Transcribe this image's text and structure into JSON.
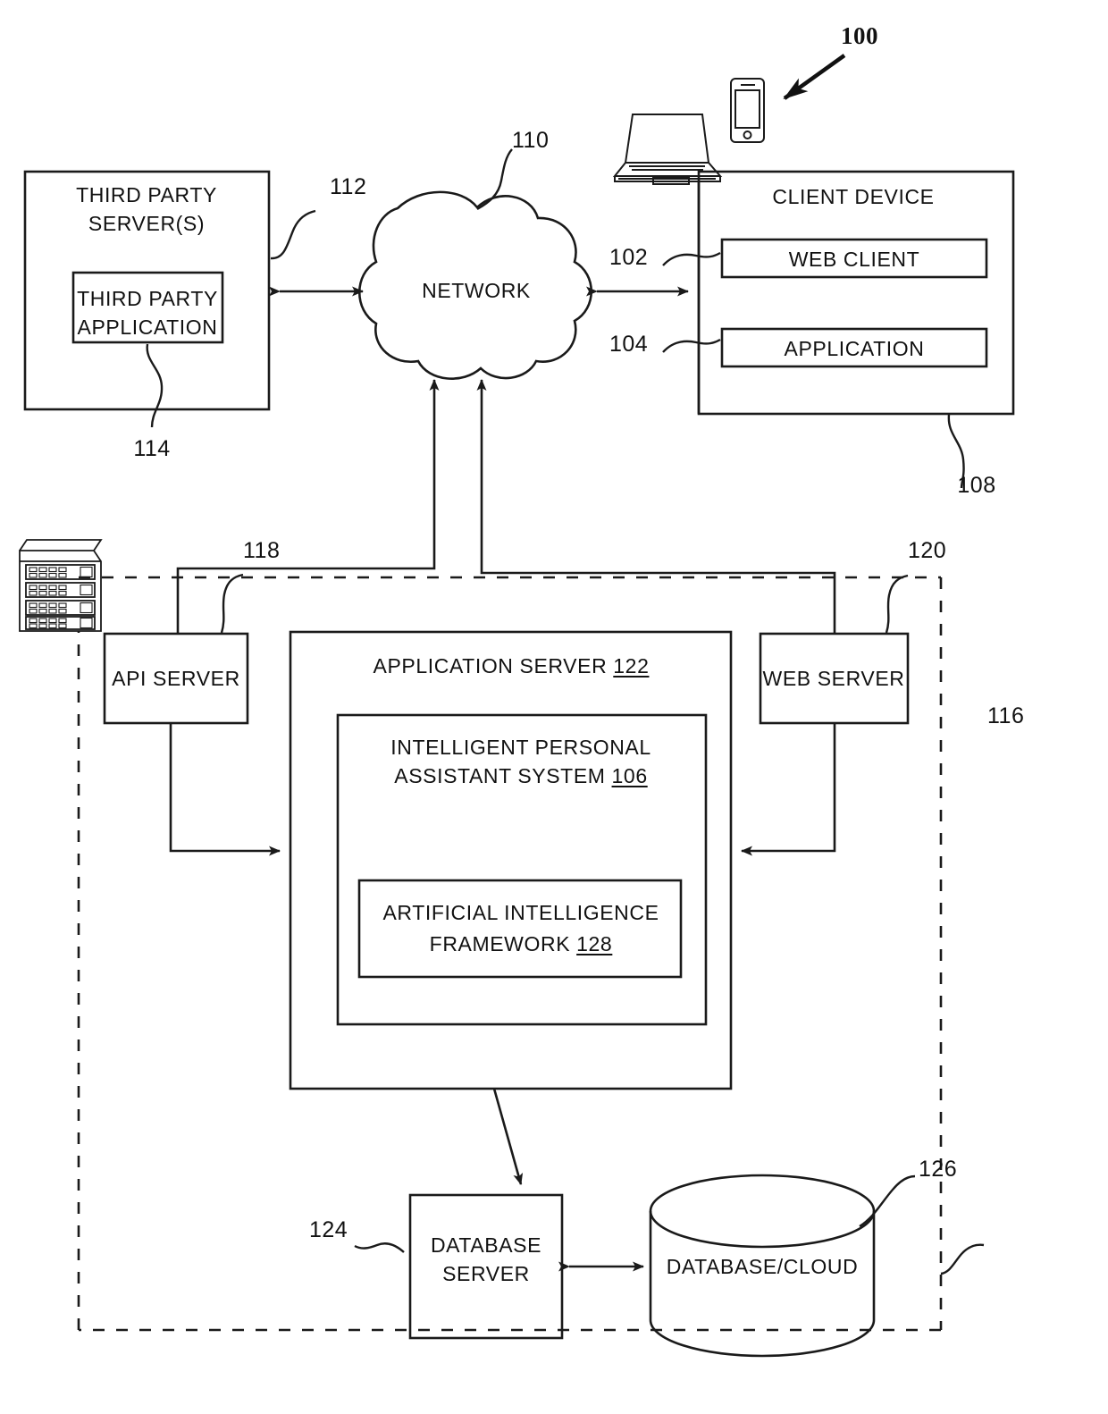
{
  "figure": {
    "reference_100": "100",
    "nodes": {
      "third_party_server": {
        "label": "THIRD PARTY\nSERVER(S)",
        "line1": "THIRD PARTY",
        "line2": "SERVER(S)",
        "ref": "112"
      },
      "third_party_application": {
        "line1": "THIRD PARTY",
        "line2": "APPLICATION",
        "ref": "114"
      },
      "network": {
        "label": "NETWORK",
        "ref": "110"
      },
      "client_device": {
        "label": "CLIENT DEVICE",
        "ref": "108"
      },
      "web_client": {
        "label": "WEB CLIENT",
        "ref": "102"
      },
      "application": {
        "label": "APPLICATION",
        "ref": "104"
      },
      "api_server": {
        "label": "API SERVER",
        "ref": "118"
      },
      "web_server": {
        "label": "WEB SERVER",
        "ref": "120"
      },
      "application_server": {
        "label": "APPLICATION SERVER",
        "ref": "122"
      },
      "intelligent_personal_assistant_system": {
        "line1": "INTELLIGENT PERSONAL",
        "line2": "ASSISTANT SYSTEM",
        "ref": "106"
      },
      "artificial_intelligence_framework": {
        "line1": "ARTIFICIAL INTELLIGENCE",
        "line2": "FRAMEWORK",
        "ref": "128"
      },
      "database_server": {
        "line1": "DATABASE",
        "line2": "SERVER",
        "ref": "124"
      },
      "database_cloud": {
        "label": "DATABASE/CLOUD",
        "ref": "126"
      },
      "networked_system": {
        "ref": "116"
      }
    },
    "icons": {
      "laptop": "laptop-icon",
      "smartphone": "smartphone-icon",
      "server_rack": "server-rack-icon",
      "cloud": "cloud-shape",
      "cylinder": "database-cylinder"
    },
    "colors": {
      "stroke": "#1a1a1a",
      "background": "#ffffff",
      "text": "#111111"
    }
  }
}
